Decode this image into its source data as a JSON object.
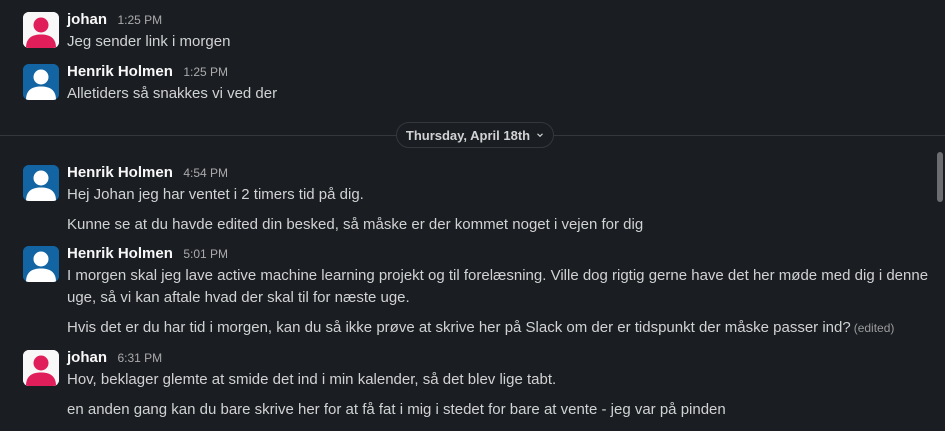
{
  "colors": {
    "background": "#1a1d21",
    "avatar_johan": "#e01e5a",
    "avatar_henrik": "#1264a3"
  },
  "date_divider": {
    "label": "Thursday, April 18th",
    "icon": "chevron-down-icon"
  },
  "messages": [
    {
      "sender": "johan",
      "time": "1:25 PM",
      "lines": [
        "Jeg sender link i morgen"
      ]
    },
    {
      "sender": "Henrik Holmen",
      "time": "1:25 PM",
      "lines": [
        "Alletiders så snakkes vi ved der"
      ]
    },
    {
      "sender": "Henrik Holmen",
      "time": "4:54 PM",
      "lines": [
        "Hej Johan jeg har ventet i 2 timers tid på dig.",
        "Kunne se at du havde edited din besked, så måske er der kommet noget i vejen for dig"
      ]
    },
    {
      "sender": "Henrik Holmen",
      "time": "5:01 PM",
      "lines": [
        "I morgen skal jeg lave active machine learning projekt og til forelæsning. Ville dog rigtig gerne have det her møde med dig i denne",
        "uge, så vi kan aftale hvad der skal til for næste uge.",
        "Hvis det er du har tid i morgen, kan du så ikke prøve at skrive her på Slack om der er tidspunkt der måske passer ind?"
      ],
      "edited_label": "(edited)"
    },
    {
      "sender": "johan",
      "time": "6:31 PM",
      "lines": [
        "Hov, beklager glemte at smide det ind i min kalender, så det blev lige tabt.",
        "en anden gang kan du bare skrive her for at få fat i mig i stedet for bare at vente - jeg var på pinden"
      ]
    }
  ]
}
